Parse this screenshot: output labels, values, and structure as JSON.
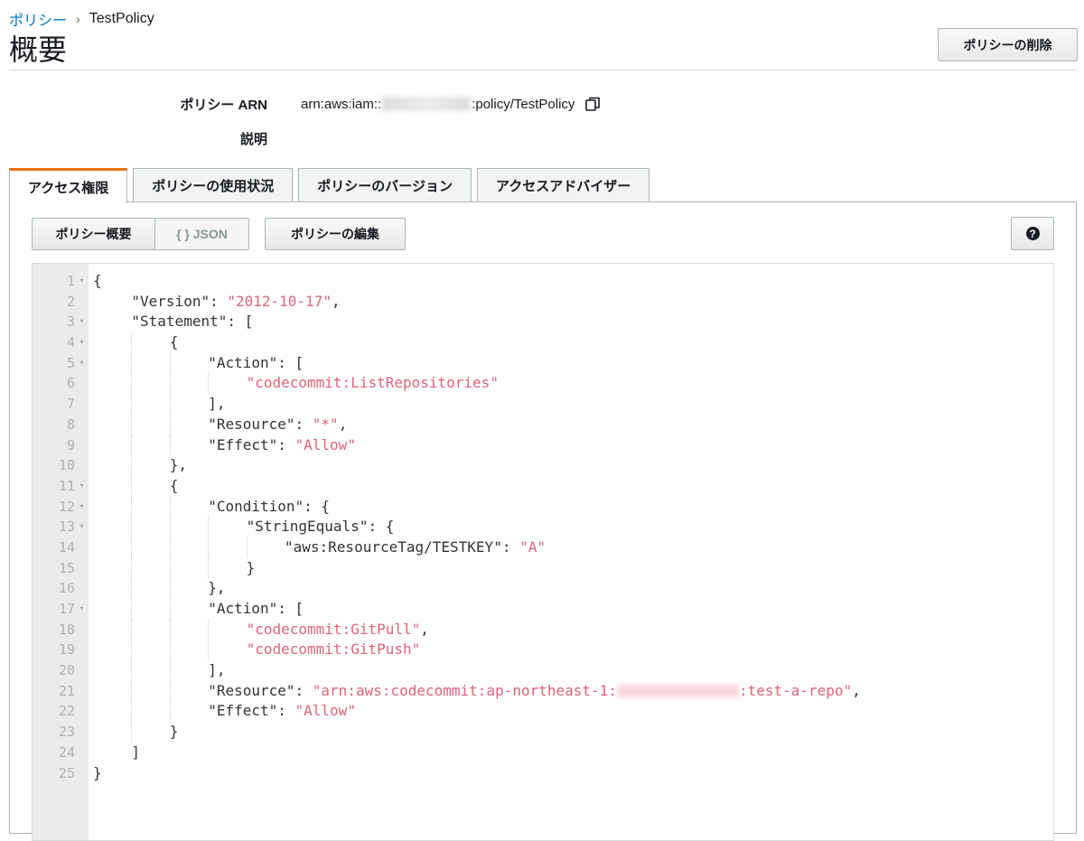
{
  "breadcrumb": {
    "parent": "ポリシー",
    "separator": "›",
    "current": "TestPolicy"
  },
  "page_title": "概要",
  "delete_button": "ポリシーの削除",
  "summary": {
    "arn_label": "ポリシー ARN",
    "arn_prefix": "arn:aws:iam::",
    "arn_suffix": ":policy/TestPolicy",
    "description_label": "説明"
  },
  "tabs": [
    {
      "label": "アクセス権限",
      "active": true
    },
    {
      "label": "ポリシーの使用状況",
      "active": false
    },
    {
      "label": "ポリシーのバージョン",
      "active": false
    },
    {
      "label": "アクセスアドバイザー",
      "active": false
    }
  ],
  "toolbar": {
    "policy_summary": "ポリシー概要",
    "json": "{ } JSON",
    "edit_policy": "ポリシーの編集",
    "help": "?"
  },
  "code_lines": [
    {
      "n": "1",
      "fold": true,
      "indent": 0,
      "parts": [
        [
          "p",
          "{"
        ]
      ]
    },
    {
      "n": "2",
      "fold": false,
      "indent": 1,
      "parts": [
        [
          "p",
          "\"Version\": "
        ],
        [
          "s",
          "\"2012-10-17\""
        ],
        [
          "p",
          ","
        ]
      ]
    },
    {
      "n": "3",
      "fold": true,
      "indent": 1,
      "parts": [
        [
          "p",
          "\"Statement\": ["
        ]
      ]
    },
    {
      "n": "4",
      "fold": true,
      "indent": 2,
      "parts": [
        [
          "p",
          "{"
        ]
      ]
    },
    {
      "n": "5",
      "fold": true,
      "indent": 3,
      "parts": [
        [
          "p",
          "\"Action\": ["
        ]
      ]
    },
    {
      "n": "6",
      "fold": false,
      "indent": 4,
      "parts": [
        [
          "s",
          "\"codecommit:ListRepositories\""
        ]
      ]
    },
    {
      "n": "7",
      "fold": false,
      "indent": 3,
      "parts": [
        [
          "p",
          "],"
        ]
      ]
    },
    {
      "n": "8",
      "fold": false,
      "indent": 3,
      "parts": [
        [
          "p",
          "\"Resource\": "
        ],
        [
          "s",
          "\"*\""
        ],
        [
          "p",
          ","
        ]
      ]
    },
    {
      "n": "9",
      "fold": false,
      "indent": 3,
      "parts": [
        [
          "p",
          "\"Effect\": "
        ],
        [
          "s",
          "\"Allow\""
        ]
      ]
    },
    {
      "n": "10",
      "fold": false,
      "indent": 2,
      "parts": [
        [
          "p",
          "},"
        ]
      ]
    },
    {
      "n": "11",
      "fold": true,
      "indent": 2,
      "parts": [
        [
          "p",
          "{"
        ]
      ]
    },
    {
      "n": "12",
      "fold": true,
      "indent": 3,
      "parts": [
        [
          "p",
          "\"Condition\": {"
        ]
      ]
    },
    {
      "n": "13",
      "fold": true,
      "indent": 4,
      "parts": [
        [
          "p",
          "\"StringEquals\": {"
        ]
      ]
    },
    {
      "n": "14",
      "fold": false,
      "indent": 5,
      "parts": [
        [
          "p",
          "\"aws:ResourceTag/TESTKEY\": "
        ],
        [
          "s",
          "\"A\""
        ]
      ]
    },
    {
      "n": "15",
      "fold": false,
      "indent": 4,
      "parts": [
        [
          "p",
          "}"
        ]
      ]
    },
    {
      "n": "16",
      "fold": false,
      "indent": 3,
      "parts": [
        [
          "p",
          "},"
        ]
      ]
    },
    {
      "n": "17",
      "fold": true,
      "indent": 3,
      "parts": [
        [
          "p",
          "\"Action\": ["
        ]
      ]
    },
    {
      "n": "18",
      "fold": false,
      "indent": 4,
      "parts": [
        [
          "s",
          "\"codecommit:GitPull\""
        ],
        [
          "p",
          ","
        ]
      ]
    },
    {
      "n": "19",
      "fold": false,
      "indent": 4,
      "parts": [
        [
          "s",
          "\"codecommit:GitPush\""
        ]
      ]
    },
    {
      "n": "20",
      "fold": false,
      "indent": 3,
      "parts": [
        [
          "p",
          "],"
        ]
      ]
    },
    {
      "n": "21",
      "fold": false,
      "indent": 3,
      "parts": [
        [
          "p",
          "\"Resource\": "
        ],
        [
          "s",
          "\"arn:aws:codecommit:ap-northeast-1:"
        ],
        [
          "r",
          ""
        ],
        [
          "s",
          ":test-a-repo\""
        ],
        [
          "p",
          ","
        ]
      ]
    },
    {
      "n": "22",
      "fold": false,
      "indent": 3,
      "parts": [
        [
          "p",
          "\"Effect\": "
        ],
        [
          "s",
          "\"Allow\""
        ]
      ]
    },
    {
      "n": "23",
      "fold": false,
      "indent": 2,
      "parts": [
        [
          "p",
          "}"
        ]
      ]
    },
    {
      "n": "24",
      "fold": false,
      "indent": 1,
      "parts": [
        [
          "p",
          "]"
        ]
      ]
    },
    {
      "n": "25",
      "fold": false,
      "indent": 0,
      "parts": [
        [
          "p",
          "}"
        ]
      ]
    }
  ]
}
